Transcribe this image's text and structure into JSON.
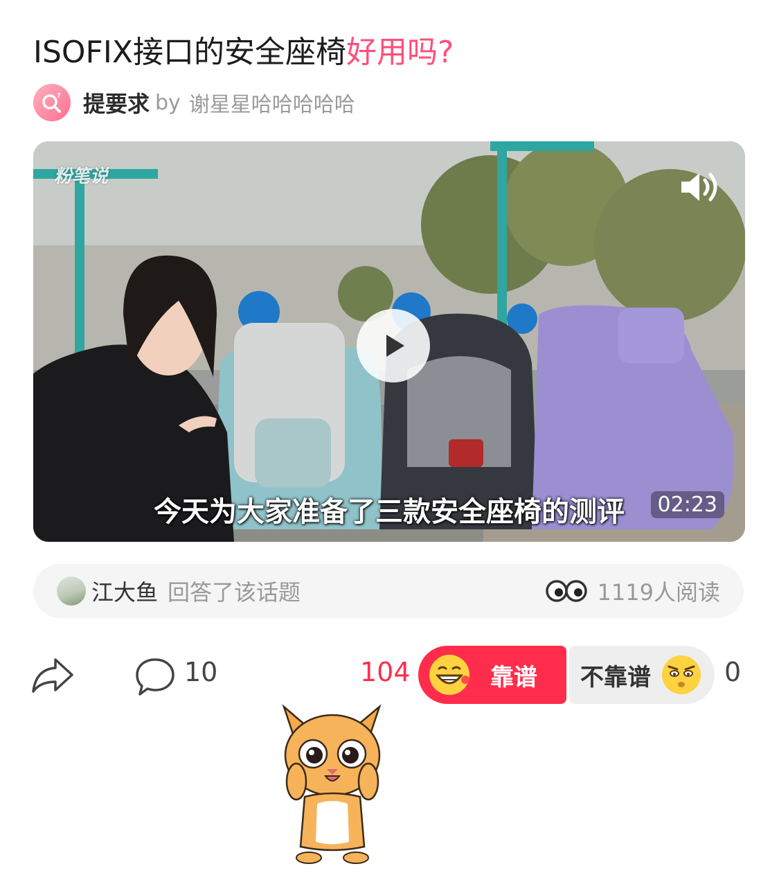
{
  "post": {
    "title_main": "ISOFIX接口的安全座椅",
    "title_highlight": "好用吗?",
    "ask_tag": "提要求",
    "ask_by": "by",
    "ask_author": "谢星星哈哈哈哈哈",
    "accent_color": "#ff4f7a"
  },
  "video": {
    "watermark": "粉笔说",
    "subtitle": "今天为大家准备了三款安全座椅的测评",
    "duration": "02:23",
    "play_icon": "play-icon",
    "sound_icon": "speaker-icon"
  },
  "answer": {
    "answerer": "江大鱼",
    "action": "回答了该话题",
    "read_count": "1119人阅读"
  },
  "actions": {
    "comment_count": "10",
    "up_count": "104",
    "up_label": "靠谱",
    "down_label": "不靠谱",
    "down_count": "0",
    "up_color": "#ff2d4b"
  }
}
